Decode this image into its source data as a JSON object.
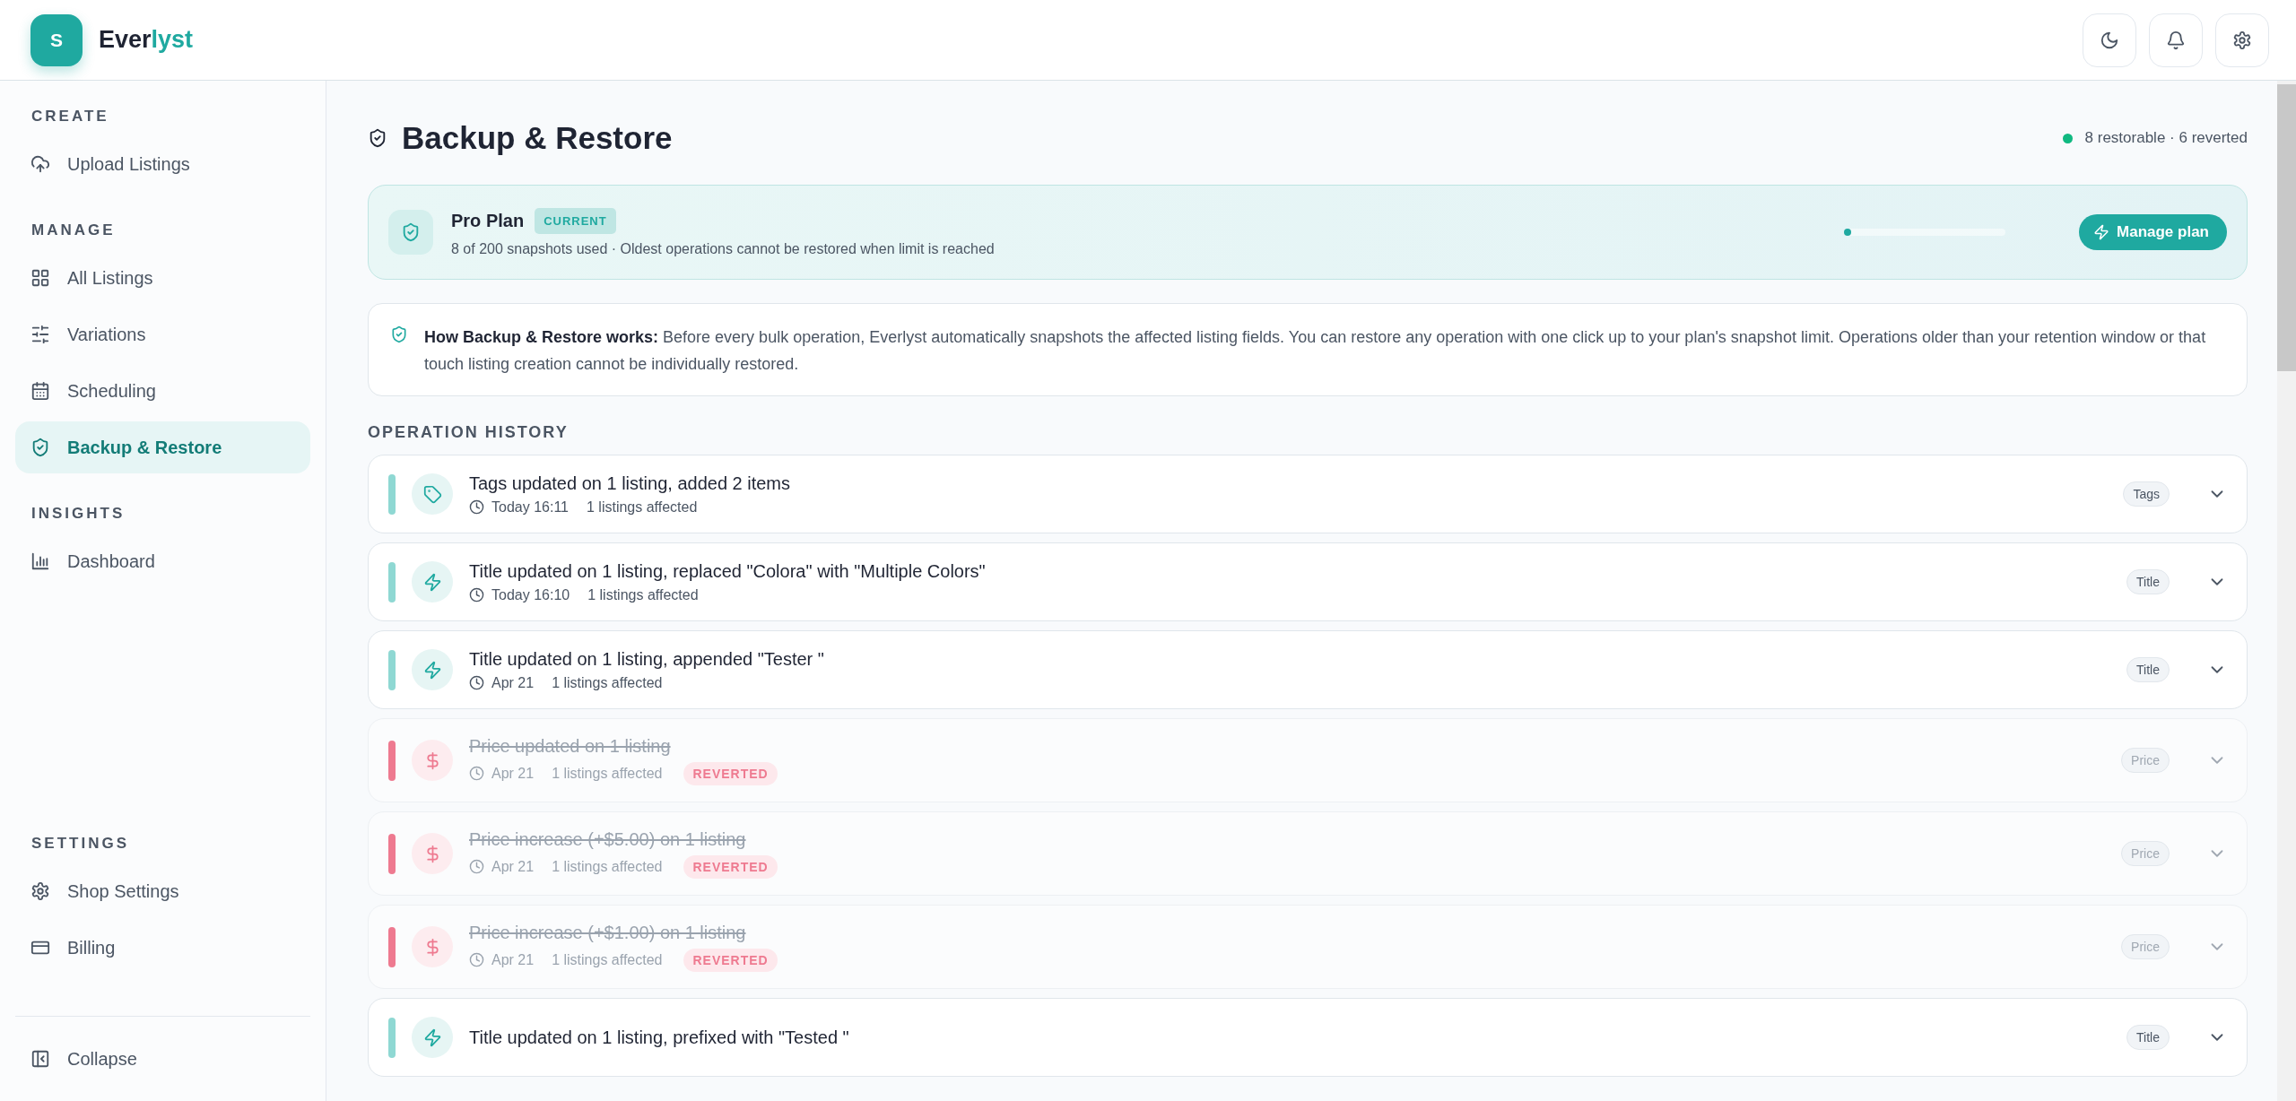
{
  "app": {
    "logo_letter": "S",
    "brand_main": "Ever",
    "brand_accent": "lyst"
  },
  "sidebar": {
    "sections": [
      {
        "heading": "CREATE",
        "items": [
          {
            "label": "Upload Listings",
            "selected": false
          }
        ]
      },
      {
        "heading": "MANAGE",
        "items": [
          {
            "label": "All Listings",
            "selected": false
          },
          {
            "label": "Variations",
            "selected": false
          },
          {
            "label": "Scheduling",
            "selected": false
          },
          {
            "label": "Backup & Restore",
            "selected": true
          }
        ]
      },
      {
        "heading": "INSIGHTS",
        "items": [
          {
            "label": "Dashboard",
            "selected": false
          }
        ]
      }
    ],
    "bottom_sections": [
      {
        "heading": "SETTINGS",
        "items": [
          {
            "label": "Shop Settings",
            "selected": false
          },
          {
            "label": "Billing",
            "selected": false
          }
        ]
      }
    ],
    "collapse": "Collapse"
  },
  "page": {
    "title": "Backup & Restore",
    "summary": "8 restorable · 6 reverted"
  },
  "plan": {
    "name": "Pro Plan",
    "badge": "CURRENT",
    "detail": "8 of 200 snapshots used · Oldest operations cannot be restored when limit is reached",
    "level": 0.04,
    "button": "Manage plan"
  },
  "info": {
    "text": "**How Backup & Restore works:** Before every bulk operation, Everlyst automatically snapshots the affected listing fields. You can restore any operation with one click up to your plan's snapshot limit. Operations older than your retention window or that touch listing creation cannot be individually restored."
  },
  "history": {
    "heading": "OPERATION HISTORY",
    "rows": [
      {
        "kind": "tags",
        "title": "Tags updated on 1 listing, added 2 items",
        "time": "Today 16:11",
        "affected": "1 listings affected",
        "reverted": false,
        "tag": "Tags"
      },
      {
        "kind": "title",
        "title": "Title updated on 1 listing, replaced \"Colora\" with \"Multiple Colors\"",
        "time": "Today 16:10",
        "affected": "1 listings affected",
        "reverted": false,
        "tag": "Title"
      },
      {
        "kind": "title",
        "title": "Title updated on 1 listing, appended \"Tester \"",
        "time": "Apr 21",
        "affected": "1 listings affected",
        "reverted": false,
        "tag": "Title"
      },
      {
        "kind": "price",
        "title": "Price updated on 1 listing",
        "time": "Apr 21",
        "affected": "1 listings affected",
        "reverted": true,
        "badge": "REVERTED",
        "tag": "Price"
      },
      {
        "kind": "price",
        "title": "Price increase (+$5.00) on 1 listing",
        "time": "Apr 21",
        "affected": "1 listings affected",
        "reverted": true,
        "badge": "REVERTED",
        "tag": "Price"
      },
      {
        "kind": "price",
        "title": "Price increase (+$1.00) on 1 listing",
        "time": "Apr 21",
        "affected": "1 listings affected",
        "reverted": true,
        "badge": "REVERTED",
        "tag": "Price"
      },
      {
        "kind": "title",
        "title": "Title updated on 1 listing, prefixed with \"Tested \"",
        "reverted": false,
        "tag": "Title"
      }
    ]
  }
}
